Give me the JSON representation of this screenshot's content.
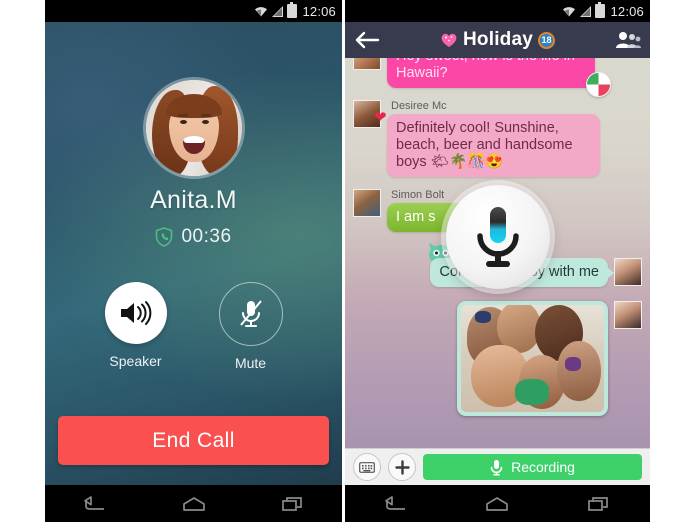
{
  "statusbar": {
    "time": "12:06",
    "icons": [
      "wifi-icon",
      "signal-icon",
      "battery-icon"
    ]
  },
  "navbar": {
    "back": "back-icon",
    "home": "home-icon",
    "recents": "recents-icon"
  },
  "call_screen": {
    "caller_name": "Anita.M",
    "duration": "00:36",
    "secure_icon": "shield-phone-icon",
    "controls": [
      {
        "label": "Speaker",
        "icon": "speaker-icon",
        "active": true
      },
      {
        "label": "Mute",
        "icon": "mute-mic-icon",
        "active": false
      }
    ],
    "end_call_label": "End Call",
    "end_call_color": "#fb5050"
  },
  "chat_screen": {
    "header": {
      "back_icon": "back-arrow-icon",
      "title": "Holiday",
      "title_icon": "pink-heart-icon",
      "badge": "18",
      "badge_color": "#2f80c9",
      "badge_ring_color": "#e0862a",
      "members_icon": "group-members-icon"
    },
    "messages": [
      {
        "sender": "",
        "text": "Hey sweet, how is the life in  Hawaii?",
        "side": "in",
        "style": "pinkhot",
        "sticker": "candy-sticker"
      },
      {
        "sender": "Desiree Mc",
        "text": "Definitely cool! Sunshine, beach, beer and handsome boys 🌤🌴🎊😍",
        "side": "in",
        "style": "pink",
        "sticker": "heart-emoji"
      },
      {
        "sender": "Simon Bolt",
        "text": "I am s",
        "side": "in",
        "style": "green",
        "sticker": ""
      },
      {
        "sender": "",
        "text": "Come and enjoy with me",
        "side": "out",
        "style": "teal",
        "sticker": "cat-sticker"
      },
      {
        "sender": "",
        "text": "",
        "side": "out",
        "style": "photo",
        "sticker": "beach-group-photo"
      }
    ],
    "recording_overlay": {
      "icon": "microphone-icon",
      "mic_accent": "#22c6e8"
    },
    "input_bar": {
      "keyboard_icon": "keyboard-icon",
      "plus_icon": "plus-icon",
      "record_label": "Recording",
      "record_icon": "microphone-icon",
      "record_color": "#3ed16a"
    }
  }
}
